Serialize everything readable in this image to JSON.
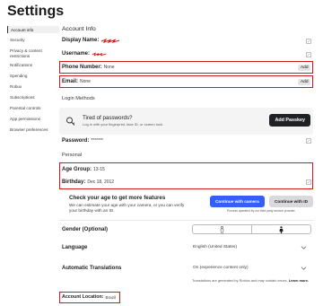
{
  "page": {
    "title": "Settings"
  },
  "sidebar": {
    "items": [
      {
        "label": "Account info"
      },
      {
        "label": "Security"
      },
      {
        "label": "Privacy & content restrictions"
      },
      {
        "label": "Notifications"
      },
      {
        "label": "Spending"
      },
      {
        "label": "Robux"
      },
      {
        "label": "Subscriptions"
      },
      {
        "label": "Parental controls"
      },
      {
        "label": "App permissions"
      },
      {
        "label": "Browser preferences"
      }
    ]
  },
  "account": {
    "section_title": "Account Info",
    "display_name_label": "Display Name:",
    "username_label": "Username:",
    "phone_label": "Phone Number:",
    "phone_value": "None",
    "email_label": "Email:",
    "email_value": "None",
    "add_label": "Add",
    "login_methods": "Login Methods",
    "passkey_title": "Tired of passwords?",
    "passkey_sub": "Log in with your fingerprint, face ID, or screen lock.",
    "passkey_button": "Add Passkey",
    "password_label": "Password:",
    "password_value": "*******",
    "personal": "Personal",
    "age_group_label": "Age Group:",
    "age_group_value": "13-15",
    "birthday_label": "Birthday:",
    "birthday_value": "Dec 18, 2012"
  },
  "age_check": {
    "title": "Check your age to get more features",
    "text": "We can estimate your age with your camera, or you can verify your birthday with an ID.",
    "camera_button": "Continue with camera",
    "id_button": "Continue with ID",
    "provider_note": "Process operated by our third party service provider"
  },
  "prefs": {
    "gender_label": "Gender (Optional)",
    "language_label": "Language",
    "language_value": "English (United States)",
    "translations_label": "Automatic Translations",
    "translations_value": "On (experience content only)",
    "translations_note": "Translations are generated by Roblox and may contain errors.",
    "learn_more": "Learn more.",
    "location_label": "Account Location:",
    "location_value": "Brazil"
  },
  "colors": {
    "highlight": "#d11919",
    "primary_button": "#335fff",
    "dark_button": "#202124"
  },
  "icons": [
    "edit-icon",
    "passkey-icon",
    "male-icon",
    "female-icon",
    "chevron-down-icon"
  ]
}
